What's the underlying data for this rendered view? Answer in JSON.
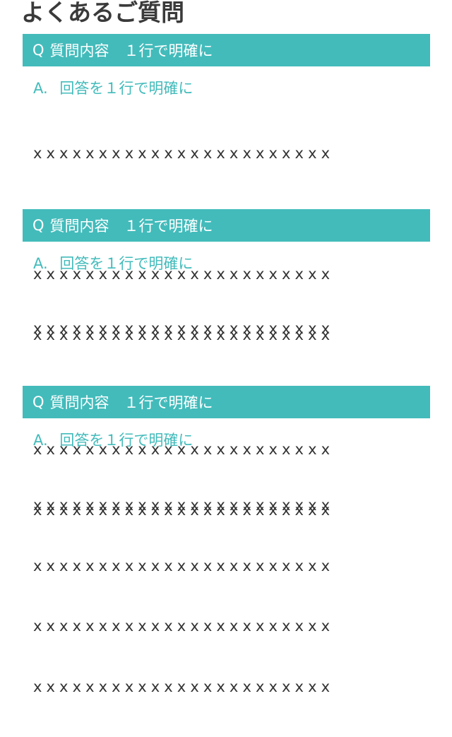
{
  "page": {
    "title": "よくあるご質問"
  },
  "faq": [
    {
      "question_mark": "Q",
      "question": "質問内容　１行で明確に",
      "answer_mark": "A.",
      "answer_lead": "回答を１行で明確に",
      "answer_lines": [
        "xxxxxxxxxxxxxxxxxxxxxxx",
        "xxxxxxxxxxxxxxxxxxxxxxx",
        "xxxxxxxxxxxxxxxxxxxxxxx",
        "xxxxxxxxxxxxxxxxxxxxxxx"
      ]
    },
    {
      "question_mark": "Q",
      "question": "質問内容　１行で明確に",
      "answer_mark": "A.",
      "answer_lead": "回答を１行で明確に",
      "answer_lines": [
        "xxxxxxxxxxxxxxxxxxxxxxx",
        "xxxxxxxxxxxxxxxxxxxxxxx",
        "xxxxxxxxxxxxxxxxxxxxxxx",
        "xxxxxxxxxxxxxxxxxxxxxxx"
      ]
    },
    {
      "question_mark": "Q",
      "question": "質問内容　１行で明確に",
      "answer_mark": "A.",
      "answer_lead": "回答を１行で明確に",
      "answer_lines": [
        "xxxxxxxxxxxxxxxxxxxxxxx",
        "xxxxxxxxxxxxxxxxxxxxxxx",
        "xxxxxxxxxxxxxxxxxxxxxxx",
        "xxxxxxxxxxxxxxxxxxxxxxx"
      ]
    }
  ],
  "colors": {
    "accent": "#43bbbb",
    "text": "#333333",
    "background": "#ffffff"
  }
}
